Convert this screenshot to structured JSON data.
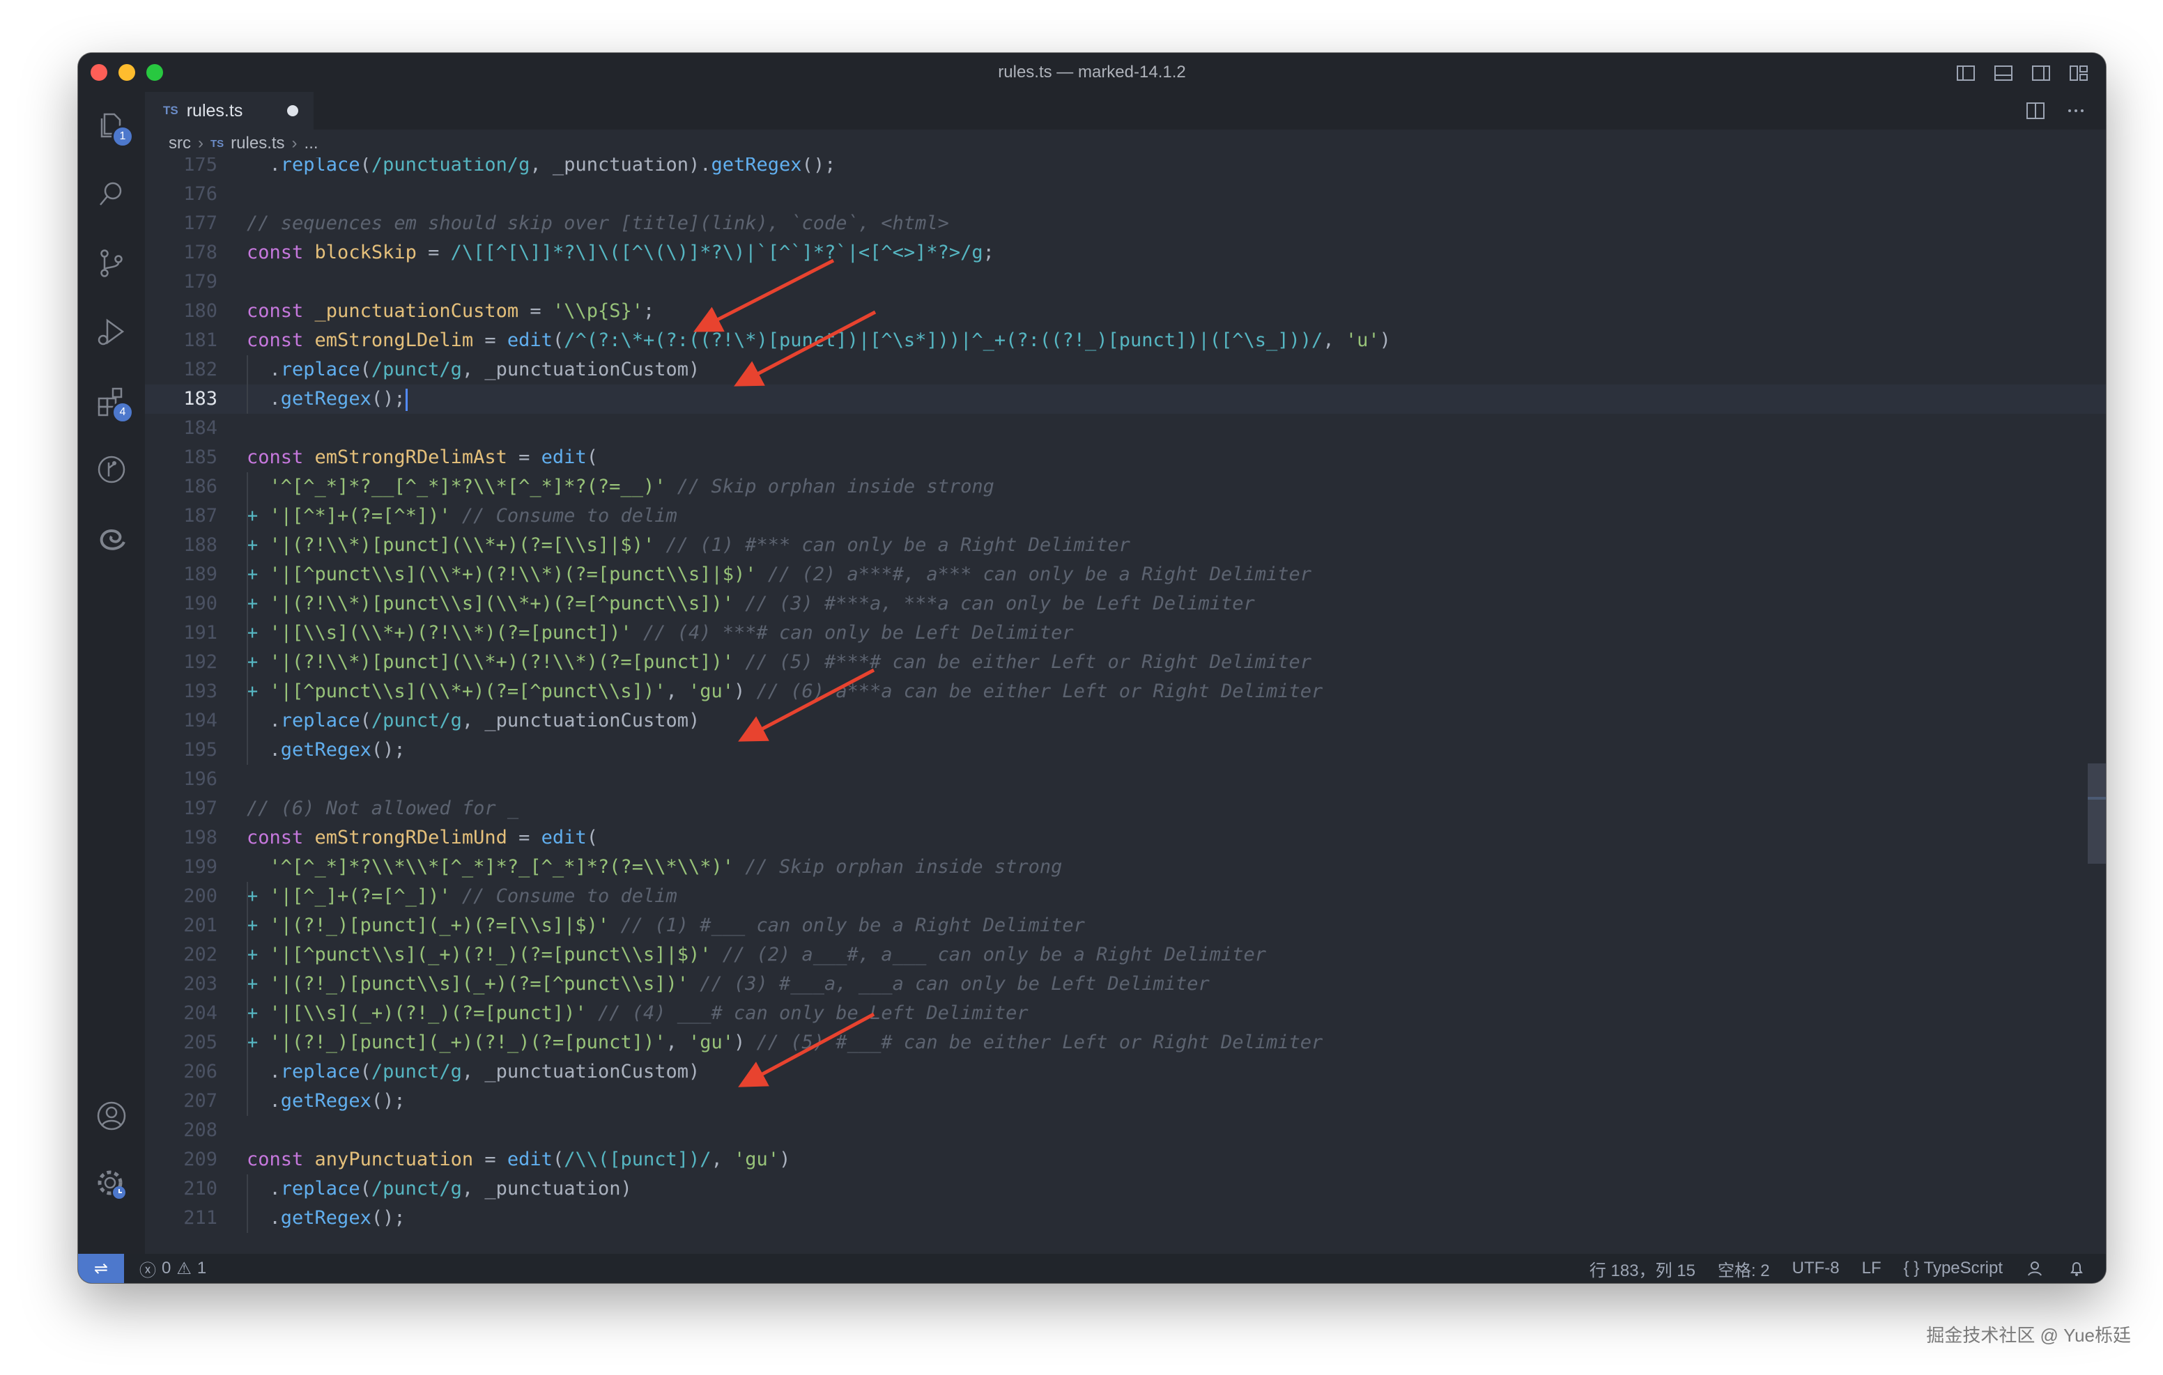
{
  "window": {
    "title": "rules.ts — marked-14.1.2"
  },
  "tab": {
    "lang": "TS",
    "name": "rules.ts"
  },
  "breadcrumb": {
    "folder": "src",
    "lang": "TS",
    "file": "rules.ts",
    "more": "..."
  },
  "activity": {
    "explorer_badge": "1",
    "extensions_badge": "4"
  },
  "status": {
    "errors": "0",
    "warnings": "1",
    "position": "行 183，列 15",
    "spaces": "空格: 2",
    "encoding": "UTF-8",
    "eol": "LF",
    "language": "TypeScript",
    "language_icon": "{ }"
  },
  "lines": [
    {
      "n": "175",
      "parts": [
        [
          "pl",
          "  ."
        ],
        [
          "fn",
          "replace"
        ],
        [
          "pl",
          "("
        ],
        [
          "re",
          "/punctuation/g"
        ],
        [
          "pl",
          ", _punctuation)."
        ],
        [
          "fn",
          "getRegex"
        ],
        [
          "pl",
          "();"
        ]
      ]
    },
    {
      "n": "176",
      "parts": []
    },
    {
      "n": "177",
      "parts": [
        [
          "cm",
          "// sequences em should skip over [title](link), `code`, <html>"
        ]
      ]
    },
    {
      "n": "178",
      "parts": [
        [
          "kw",
          "const "
        ],
        [
          "var",
          "blockSkip"
        ],
        [
          "pl",
          " = "
        ],
        [
          "re",
          "/\\[[^[\\]]*?\\]\\([^\\(\\)]*?\\)|`[^`]*?`|<[^<>]*?>/g"
        ],
        [
          "pl",
          ";"
        ]
      ]
    },
    {
      "n": "179",
      "parts": []
    },
    {
      "n": "180",
      "parts": [
        [
          "kw",
          "const "
        ],
        [
          "var",
          "_punctuationCustom"
        ],
        [
          "pl",
          " = "
        ],
        [
          "str",
          "'\\\\p{S}'"
        ],
        [
          "pl",
          ";"
        ]
      ]
    },
    {
      "n": "181",
      "parts": [
        [
          "kw",
          "const "
        ],
        [
          "var",
          "emStrongLDelim"
        ],
        [
          "pl",
          " = "
        ],
        [
          "fn",
          "edit"
        ],
        [
          "pl",
          "("
        ],
        [
          "re",
          "/^(?:\\*+(?:((?!\\*)[punct])|[^\\s*]))|^_+(?:((?!_)[punct])|([^\\s_]))/"
        ],
        [
          "pl",
          ", "
        ],
        [
          "str",
          "'u'"
        ],
        [
          "pl",
          ")"
        ]
      ]
    },
    {
      "n": "182",
      "parts": [
        [
          "pl",
          "  ."
        ],
        [
          "fn",
          "replace"
        ],
        [
          "pl",
          "("
        ],
        [
          "re",
          "/punct/g"
        ],
        [
          "pl",
          ", _punctuationCustom)"
        ]
      ]
    },
    {
      "n": "183",
      "parts": [
        [
          "pl",
          "  ."
        ],
        [
          "fn",
          "getRegex"
        ],
        [
          "pl",
          "();"
        ]
      ],
      "current": true
    },
    {
      "n": "184",
      "parts": []
    },
    {
      "n": "185",
      "parts": [
        [
          "kw",
          "const "
        ],
        [
          "var",
          "emStrongRDelimAst"
        ],
        [
          "pl",
          " = "
        ],
        [
          "fn",
          "edit"
        ],
        [
          "pl",
          "("
        ]
      ]
    },
    {
      "n": "186",
      "parts": [
        [
          "pl",
          "  "
        ],
        [
          "str",
          "'^[^_*]*?__[^_*]*?\\\\*[^_*]*?(?=__)'"
        ],
        [
          "pl",
          " "
        ],
        [
          "cm",
          "// Skip orphan inside strong"
        ]
      ]
    },
    {
      "n": "187",
      "parts": [
        [
          "op",
          "+ "
        ],
        [
          "str",
          "'|[^*]+(?=[^*])'"
        ],
        [
          "pl",
          " "
        ],
        [
          "cm",
          "// Consume to delim"
        ]
      ]
    },
    {
      "n": "188",
      "parts": [
        [
          "op",
          "+ "
        ],
        [
          "str",
          "'|(?!\\\\*)[punct](\\\\*+)(?=[\\\\s]|$)'"
        ],
        [
          "pl",
          " "
        ],
        [
          "cm",
          "// (1) #*** can only be a Right Delimiter"
        ]
      ]
    },
    {
      "n": "189",
      "parts": [
        [
          "op",
          "+ "
        ],
        [
          "str",
          "'|[^punct\\\\s](\\\\*+)(?!\\\\*)(?=[punct\\\\s]|$)'"
        ],
        [
          "pl",
          " "
        ],
        [
          "cm",
          "// (2) a***#, a*** can only be a Right Delimiter"
        ]
      ]
    },
    {
      "n": "190",
      "parts": [
        [
          "op",
          "+ "
        ],
        [
          "str",
          "'|(?!\\\\*)[punct\\\\s](\\\\*+)(?=[^punct\\\\s])'"
        ],
        [
          "pl",
          " "
        ],
        [
          "cm",
          "// (3) #***a, ***a can only be Left Delimiter"
        ]
      ]
    },
    {
      "n": "191",
      "parts": [
        [
          "op",
          "+ "
        ],
        [
          "str",
          "'|[\\\\s](\\\\*+)(?!\\\\*)(?=[punct])'"
        ],
        [
          "pl",
          " "
        ],
        [
          "cm",
          "// (4) ***# can only be Left Delimiter"
        ]
      ]
    },
    {
      "n": "192",
      "parts": [
        [
          "op",
          "+ "
        ],
        [
          "str",
          "'|(?!\\\\*)[punct](\\\\*+)(?!\\\\*)(?=[punct])'"
        ],
        [
          "pl",
          " "
        ],
        [
          "cm",
          "// (5) #***# can be either Left or Right Delimiter"
        ]
      ]
    },
    {
      "n": "193",
      "parts": [
        [
          "op",
          "+ "
        ],
        [
          "str",
          "'|[^punct\\\\s](\\\\*+)(?=[^punct\\\\s])'"
        ],
        [
          "pl",
          ", "
        ],
        [
          "str",
          "'gu'"
        ],
        [
          "pl",
          ") "
        ],
        [
          "cm",
          "// (6) a***a can be either Left or Right Delimiter"
        ]
      ]
    },
    {
      "n": "194",
      "parts": [
        [
          "pl",
          "  ."
        ],
        [
          "fn",
          "replace"
        ],
        [
          "pl",
          "("
        ],
        [
          "re",
          "/punct/g"
        ],
        [
          "pl",
          ", _punctuationCustom)"
        ]
      ]
    },
    {
      "n": "195",
      "parts": [
        [
          "pl",
          "  ."
        ],
        [
          "fn",
          "getRegex"
        ],
        [
          "pl",
          "();"
        ]
      ]
    },
    {
      "n": "196",
      "parts": []
    },
    {
      "n": "197",
      "parts": [
        [
          "cm",
          "// (6) Not allowed for _"
        ]
      ]
    },
    {
      "n": "198",
      "parts": [
        [
          "kw",
          "const "
        ],
        [
          "var",
          "emStrongRDelimUnd"
        ],
        [
          "pl",
          " = "
        ],
        [
          "fn",
          "edit"
        ],
        [
          "pl",
          "("
        ]
      ]
    },
    {
      "n": "199",
      "parts": [
        [
          "pl",
          "  "
        ],
        [
          "str",
          "'^[^_*]*?\\\\*\\\\*[^_*]*?_[^_*]*?(?=\\\\*\\\\*)'"
        ],
        [
          "pl",
          " "
        ],
        [
          "cm",
          "// Skip orphan inside strong"
        ]
      ]
    },
    {
      "n": "200",
      "parts": [
        [
          "op",
          "+ "
        ],
        [
          "str",
          "'|[^_]+(?=[^_])'"
        ],
        [
          "pl",
          " "
        ],
        [
          "cm",
          "// Consume to delim"
        ]
      ]
    },
    {
      "n": "201",
      "parts": [
        [
          "op",
          "+ "
        ],
        [
          "str",
          "'|(?!_)[punct](_+)(?=[\\\\s]|$)'"
        ],
        [
          "pl",
          " "
        ],
        [
          "cm",
          "// (1) #___ can only be a Right Delimiter"
        ]
      ]
    },
    {
      "n": "202",
      "parts": [
        [
          "op",
          "+ "
        ],
        [
          "str",
          "'|[^punct\\\\s](_+)(?!_)(?=[punct\\\\s]|$)'"
        ],
        [
          "pl",
          " "
        ],
        [
          "cm",
          "// (2) a___#, a___ can only be a Right Delimiter"
        ]
      ]
    },
    {
      "n": "203",
      "parts": [
        [
          "op",
          "+ "
        ],
        [
          "str",
          "'|(?!_)[punct\\\\s](_+)(?=[^punct\\\\s])'"
        ],
        [
          "pl",
          " "
        ],
        [
          "cm",
          "// (3) #___a, ___a can only be Left Delimiter"
        ]
      ]
    },
    {
      "n": "204",
      "parts": [
        [
          "op",
          "+ "
        ],
        [
          "str",
          "'|[\\\\s](_+)(?!_)(?=[punct])'"
        ],
        [
          "pl",
          " "
        ],
        [
          "cm",
          "// (4) ___# can only be Left Delimiter"
        ]
      ]
    },
    {
      "n": "205",
      "parts": [
        [
          "op",
          "+ "
        ],
        [
          "str",
          "'|(?!_)[punct](_+)(?!_)(?=[punct])'"
        ],
        [
          "pl",
          ", "
        ],
        [
          "str",
          "'gu'"
        ],
        [
          "pl",
          ") "
        ],
        [
          "cm",
          "// (5) #___# can be either Left or Right Delimiter"
        ]
      ]
    },
    {
      "n": "206",
      "parts": [
        [
          "pl",
          "  ."
        ],
        [
          "fn",
          "replace"
        ],
        [
          "pl",
          "("
        ],
        [
          "re",
          "/punct/g"
        ],
        [
          "pl",
          ", _punctuationCustom)"
        ]
      ]
    },
    {
      "n": "207",
      "parts": [
        [
          "pl",
          "  ."
        ],
        [
          "fn",
          "getRegex"
        ],
        [
          "pl",
          "();"
        ]
      ]
    },
    {
      "n": "208",
      "parts": []
    },
    {
      "n": "209",
      "parts": [
        [
          "kw",
          "const "
        ],
        [
          "var",
          "anyPunctuation"
        ],
        [
          "pl",
          " = "
        ],
        [
          "fn",
          "edit"
        ],
        [
          "pl",
          "("
        ],
        [
          "re",
          "/\\\\([punct])/"
        ],
        [
          "pl",
          ", "
        ],
        [
          "str",
          "'gu'"
        ],
        [
          "pl",
          ")"
        ]
      ]
    },
    {
      "n": "210",
      "parts": [
        [
          "pl",
          "  ."
        ],
        [
          "fn",
          "replace"
        ],
        [
          "pl",
          "("
        ],
        [
          "re",
          "/punct/g"
        ],
        [
          "pl",
          ", _punctuation)"
        ]
      ]
    },
    {
      "n": "211",
      "parts": [
        [
          "pl",
          "  ."
        ],
        [
          "fn",
          "getRegex"
        ],
        [
          "pl",
          "();"
        ]
      ]
    }
  ],
  "watermark": "掘金技术社区 @ Yue栎廷",
  "colors": {
    "annotation_arrow": "#e8432f",
    "accent": "#4d78cc"
  }
}
